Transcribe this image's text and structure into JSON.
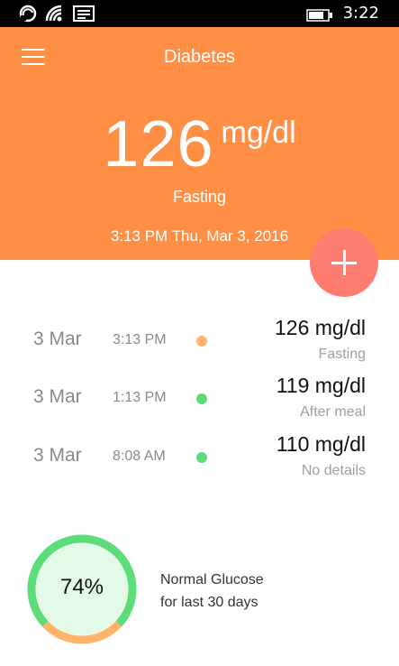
{
  "status_bar": {
    "time": "3:22",
    "icons": [
      "sync-icon",
      "wifi-icon",
      "message-icon",
      "battery-icon"
    ]
  },
  "header": {
    "title": "Diabetes",
    "menu_icon": "hamburger-menu-icon",
    "current_reading": {
      "value": "126",
      "unit": "mg/dl",
      "type": "Fasting",
      "datetime": "3:13 PM Thu, Mar 3, 2016"
    },
    "add_button_icon": "plus-icon"
  },
  "readings": [
    {
      "date": "3 Mar",
      "time": "3:13 PM",
      "value": "126 mg/dl",
      "note": "Fasting",
      "status_color": "#FFB36B"
    },
    {
      "date": "3 Mar",
      "time": "1:13 PM",
      "value": "119 mg/dl",
      "note": "After meal",
      "status_color": "#5DDC7A"
    },
    {
      "date": "3 Mar",
      "time": "8:08 AM",
      "value": "110 mg/dl",
      "note": "No details",
      "status_color": "#5DDC7A"
    }
  ],
  "summary": {
    "percent_label": "74%",
    "percent": 0.74,
    "line1": "Normal Glucose",
    "line2": "for last 30 days"
  },
  "colors": {
    "header_bg": "#FF8F45",
    "add_button": "#FF7D70",
    "normal": "#5DDC7A",
    "warning": "#FFB36B",
    "gauge_fill": "#E3FBE6"
  }
}
